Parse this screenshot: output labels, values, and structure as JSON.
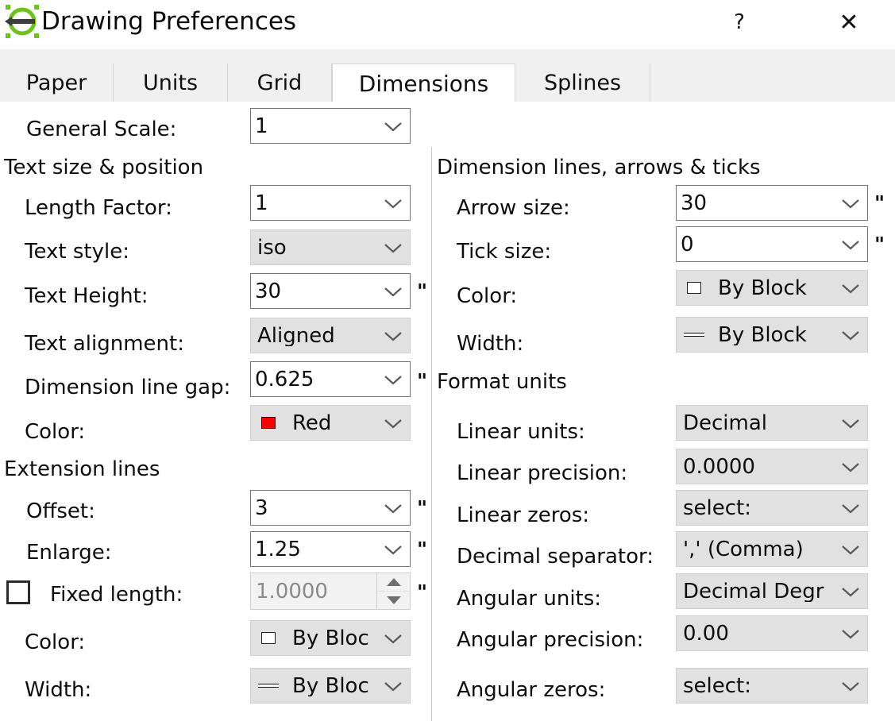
{
  "window": {
    "title": "Drawing Preferences",
    "icon": "drawing-app-icon",
    "help_label": "?",
    "close_label": "✕",
    "accent_color": "#6cc417"
  },
  "tabs": [
    {
      "id": "paper",
      "label": "Paper",
      "active": false
    },
    {
      "id": "units",
      "label": "Units",
      "active": false
    },
    {
      "id": "grid",
      "label": "Grid",
      "active": false
    },
    {
      "id": "dimensions",
      "label": "Dimensions",
      "active": true
    },
    {
      "id": "splines",
      "label": "Splines",
      "active": false
    }
  ],
  "left_column": {
    "general_scale": {
      "label": "General Scale:",
      "value": "1",
      "type": "editable"
    },
    "groups": [
      {
        "id": "text-size-position",
        "title": "Text size & position",
        "fields": [
          {
            "id": "length-factor",
            "label": "Length Factor:",
            "value": "1",
            "type": "editable",
            "unit": ""
          },
          {
            "id": "text-style",
            "label": "Text style:",
            "value": "iso",
            "type": "dropdown",
            "unit": ""
          },
          {
            "id": "text-height",
            "label": "Text Height:",
            "value": "30",
            "type": "editable",
            "unit": "\""
          },
          {
            "id": "text-alignment",
            "label": "Text alignment:",
            "value": "Aligned",
            "type": "dropdown",
            "unit": ""
          },
          {
            "id": "dimension-line-gap",
            "label": "Dimension line gap:",
            "value": "0.625",
            "type": "editable",
            "unit": "\""
          },
          {
            "id": "text-color",
            "label": "Color:",
            "value": "Red",
            "type": "dropdown",
            "unit": "",
            "swatch": "color-swatch",
            "swatch_color": "#ff0000"
          }
        ]
      },
      {
        "id": "extension-lines",
        "title": "Extension lines",
        "fields": [
          {
            "id": "offset",
            "label": "Offset:",
            "value": "3",
            "type": "editable",
            "unit": "\""
          },
          {
            "id": "enlarge",
            "label": "Enlarge:",
            "value": "1.25",
            "type": "editable",
            "unit": "\""
          },
          {
            "id": "fixed-length",
            "label": "Fixed length:",
            "value": "1.0000",
            "type": "spinner",
            "unit": "\"",
            "checkbox": true,
            "checked": false,
            "disabled": true
          },
          {
            "id": "ext-color",
            "label": "Color:",
            "value": "By Bloc",
            "type": "dropdown",
            "unit": "",
            "swatch": "color-swatch",
            "swatch_color": "#ffffff"
          },
          {
            "id": "ext-width",
            "label": "Width:",
            "value": "By Bloc",
            "type": "dropdown",
            "unit": "",
            "swatch": "line-swatch"
          }
        ]
      }
    ]
  },
  "right_column": {
    "groups": [
      {
        "id": "dimension-lines-arrows-ticks",
        "title": "Dimension lines, arrows & ticks",
        "fields": [
          {
            "id": "arrow-size",
            "label": "Arrow size:",
            "value": "30",
            "type": "editable",
            "unit": "\""
          },
          {
            "id": "tick-size",
            "label": "Tick size:",
            "value": "0",
            "type": "editable",
            "unit": "\""
          },
          {
            "id": "dim-color",
            "label": "Color:",
            "value": "By Block",
            "type": "dropdown",
            "unit": "",
            "swatch": "color-swatch",
            "swatch_color": "#ffffff"
          },
          {
            "id": "dim-width",
            "label": "Width:",
            "value": "By Block",
            "type": "dropdown",
            "unit": "",
            "swatch": "line-swatch"
          }
        ]
      },
      {
        "id": "format-units",
        "title": "Format units",
        "fields": [
          {
            "id": "linear-units",
            "label": "Linear units:",
            "value": "Decimal",
            "type": "dropdown",
            "unit": ""
          },
          {
            "id": "linear-precision",
            "label": "Linear precision:",
            "value": "0.0000",
            "type": "dropdown",
            "unit": ""
          },
          {
            "id": "linear-zeros",
            "label": "Linear zeros:",
            "value": "select:",
            "type": "dropdown",
            "unit": ""
          },
          {
            "id": "decimal-separator",
            "label": "Decimal separator:",
            "value": "',' (Comma)",
            "type": "dropdown",
            "unit": ""
          },
          {
            "id": "angular-units",
            "label": "Angular units:",
            "value": "Decimal Degr",
            "type": "dropdown",
            "unit": ""
          },
          {
            "id": "angular-precision",
            "label": "Angular precision:",
            "value": "0.00",
            "type": "dropdown",
            "unit": ""
          },
          {
            "id": "angular-zeros",
            "label": "Angular zeros:",
            "value": "select:",
            "type": "dropdown",
            "unit": ""
          }
        ]
      }
    ]
  }
}
